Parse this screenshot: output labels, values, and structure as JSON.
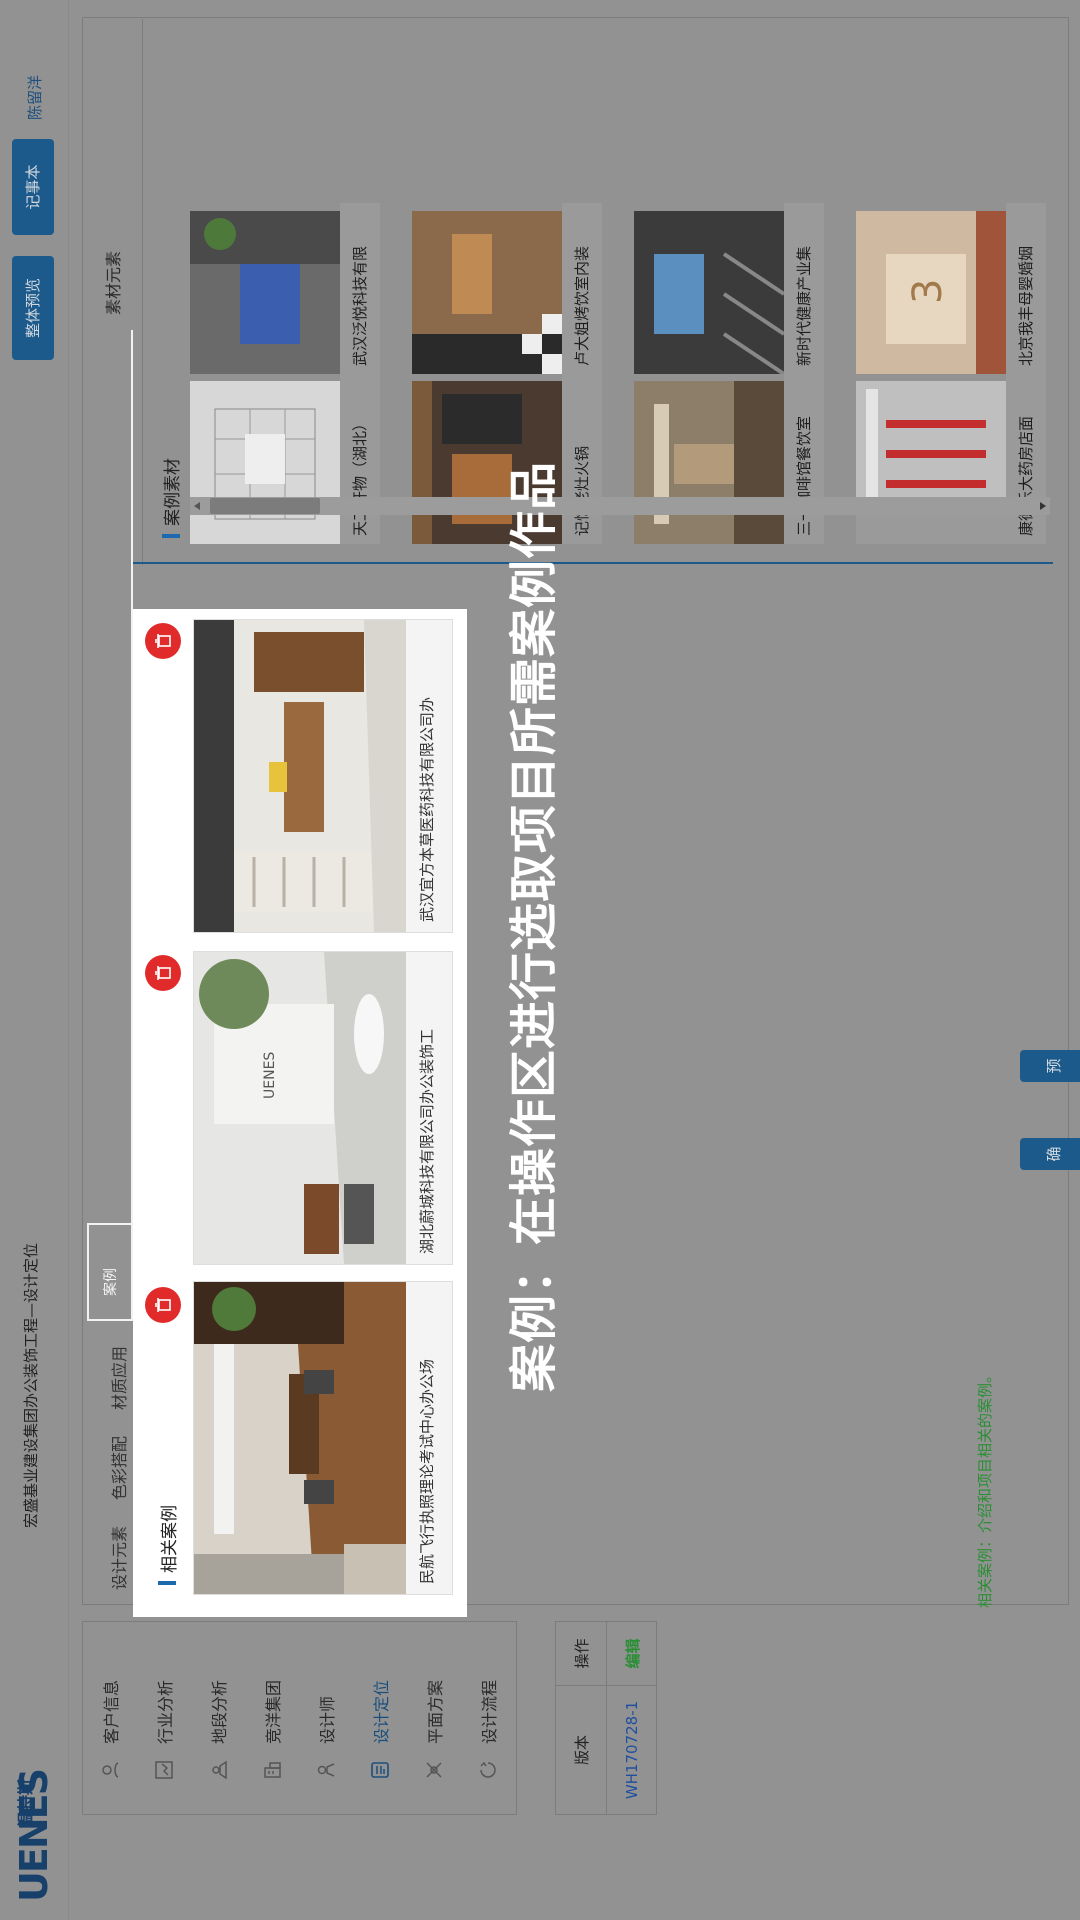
{
  "header": {
    "logo_mark": "UENES",
    "logo_cn": "温特斯",
    "breadcrumb": "宏盛基业建设集团办公装饰工程—设计定位",
    "btn_preview_all": "整体预览",
    "btn_notes": "记事本",
    "user": "陈留洋"
  },
  "sidebar": {
    "items": [
      {
        "label": "客户信息",
        "icon": "user-icon"
      },
      {
        "label": "行业分析",
        "icon": "chart-icon"
      },
      {
        "label": "地段分析",
        "icon": "location-icon"
      },
      {
        "label": "竞洋集团",
        "icon": "building-icon"
      },
      {
        "label": "设计师",
        "icon": "designer-icon"
      },
      {
        "label": "设计定位",
        "icon": "document-icon"
      },
      {
        "label": "平面方案",
        "icon": "plan-icon"
      },
      {
        "label": "设计流程",
        "icon": "flow-icon"
      }
    ],
    "active_index": 5
  },
  "version_table": {
    "col_version": "版本",
    "col_action": "操作",
    "version": "WH170728-1",
    "action": "编辑"
  },
  "tabs": [
    {
      "label": "设计元素"
    },
    {
      "label": "色彩搭配"
    },
    {
      "label": "材质应用"
    },
    {
      "label": "案例"
    }
  ],
  "related": {
    "title": "相关案例",
    "cases": [
      {
        "caption": "民航飞行执照理论考试中心办公场"
      },
      {
        "caption": "湖北蔚城科技有限公司办公装饰工"
      },
      {
        "caption": "武汉宜方本草医药科技有限公司办"
      }
    ]
  },
  "materials": {
    "header": "素材元素",
    "title": "案例素材",
    "items": [
      {
        "caption": "天工开物（湖北）"
      },
      {
        "caption": "武汉泛悦科技有限"
      },
      {
        "caption": "记忆老灶火锅"
      },
      {
        "caption": "卢大姐烤饮室内装"
      },
      {
        "caption": "三一咖啡馆餐饮室"
      },
      {
        "caption": "新时代健康产业集"
      },
      {
        "caption": "康德乐大药房店面"
      },
      {
        "caption": "北京我丰母婴婚姻"
      }
    ]
  },
  "overlay_text": "案例：在操作区进行选取项目所需案例作品",
  "info_text": "相关案例：介绍和项目相关的案例。",
  "buttons": {
    "confirm": "确 定",
    "preview": "预 览"
  },
  "colors": {
    "accent": "#1c5a8c",
    "danger": "#e12b2b",
    "success": "#2a8f34",
    "dim_bg": "#929292"
  }
}
